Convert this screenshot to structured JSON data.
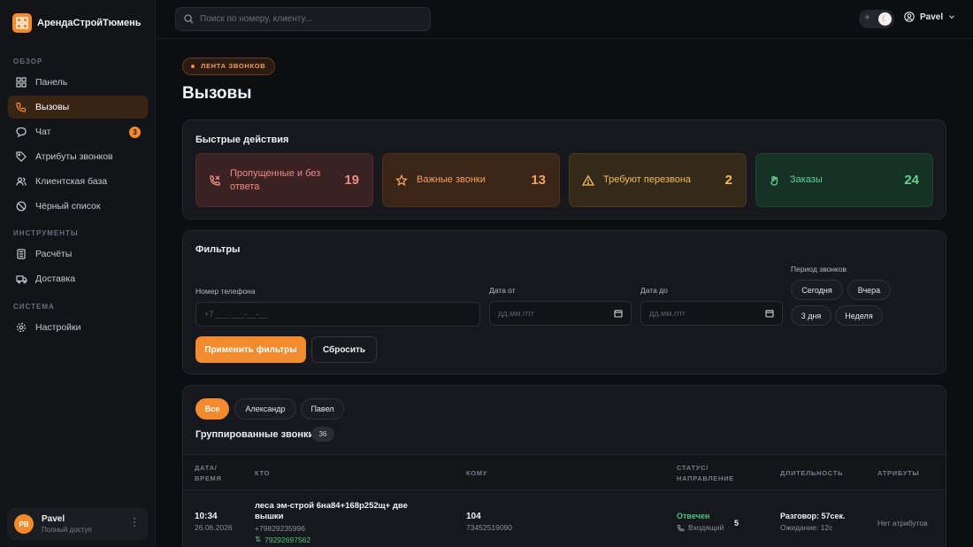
{
  "brand": {
    "name": "АрендаСтройТюмень"
  },
  "sidebar": {
    "sections": [
      "ОБЗОР",
      "ИНСТРУМЕНТЫ",
      "СИСТЕМА"
    ],
    "items": [
      {
        "label": "Панель",
        "icon": "dashboard-icon"
      },
      {
        "label": "Вызовы",
        "icon": "phone-icon",
        "active": true
      },
      {
        "label": "Чат",
        "icon": "chat-icon",
        "badge": "3"
      },
      {
        "label": "Атрибуты звонков",
        "icon": "tag-icon"
      },
      {
        "label": "Клиентская база",
        "icon": "users-icon"
      },
      {
        "label": "Чёрный список",
        "icon": "block-icon"
      },
      {
        "label": "Расчёты",
        "icon": "calculator-icon"
      },
      {
        "label": "Доставка",
        "icon": "truck-icon"
      },
      {
        "label": "Настройки",
        "icon": "gear-icon"
      }
    ],
    "user": {
      "initials": "PB",
      "name": "Pavel",
      "role": "Полный доступ"
    }
  },
  "header": {
    "search_placeholder": "Поиск по номеру, клиенту...",
    "user_name": "Pavel"
  },
  "page": {
    "crumb": "ЛЕНТА ЗВОНКОВ",
    "title": "Вызовы"
  },
  "quick_actions": {
    "title": "Быстрые действия",
    "items": [
      {
        "label": "Пропущенные и без ответа",
        "count": "19",
        "color": "#f08b86"
      },
      {
        "label": "Важные звонки",
        "count": "13",
        "color": "#f5a160"
      },
      {
        "label": "Требуют перезвона",
        "count": "2",
        "color": "#f2bd5b"
      },
      {
        "label": "Заказы",
        "count": "24",
        "color": "#5fd58d"
      }
    ]
  },
  "filters": {
    "title": "Фильтры",
    "phone_label": "Номер телефона",
    "phone_placeholder": "+7 ___ ___-__-__",
    "date_from_label": "Дата от",
    "date_to_label": "Дата до",
    "date_placeholder": "дд.мм.гггг",
    "period_label": "Период звонков",
    "periods": [
      "Сегодня",
      "Вчера",
      "3 дня",
      "Неделя"
    ],
    "apply": "Применить фильтры",
    "reset": "Сбросить"
  },
  "calls": {
    "tabs": [
      "Все",
      "Александр",
      "Павел"
    ],
    "grouped_title": "Группированные звонки",
    "grouped_count": "36",
    "columns": [
      "ДАТА/ ВРЕМЯ",
      "КТО",
      "КОМУ",
      "СТАТУС/ НАПРАВЛЕНИЕ",
      "ДЛИТЕЛЬНОСТЬ",
      "АТРИБУТЫ"
    ],
    "rows": [
      {
        "time": "10:34",
        "date": "26.06.2026",
        "who": "леса эм-строй 6на84+168р252щ+ две вышки",
        "who_phone": "+79829235996",
        "who_extra": "79292697562",
        "to": "104",
        "to_phone": "73452519090",
        "status": "Отвечен",
        "direction": "Входящий",
        "count": "5",
        "talk": "Разговор: 57сек.",
        "wait": "Ожидание: 12с",
        "attributes": "Нет атрибутов"
      }
    ]
  },
  "colors": {
    "accent": "#f28a2e",
    "background": "#0d0e11",
    "card": "#17181d"
  }
}
